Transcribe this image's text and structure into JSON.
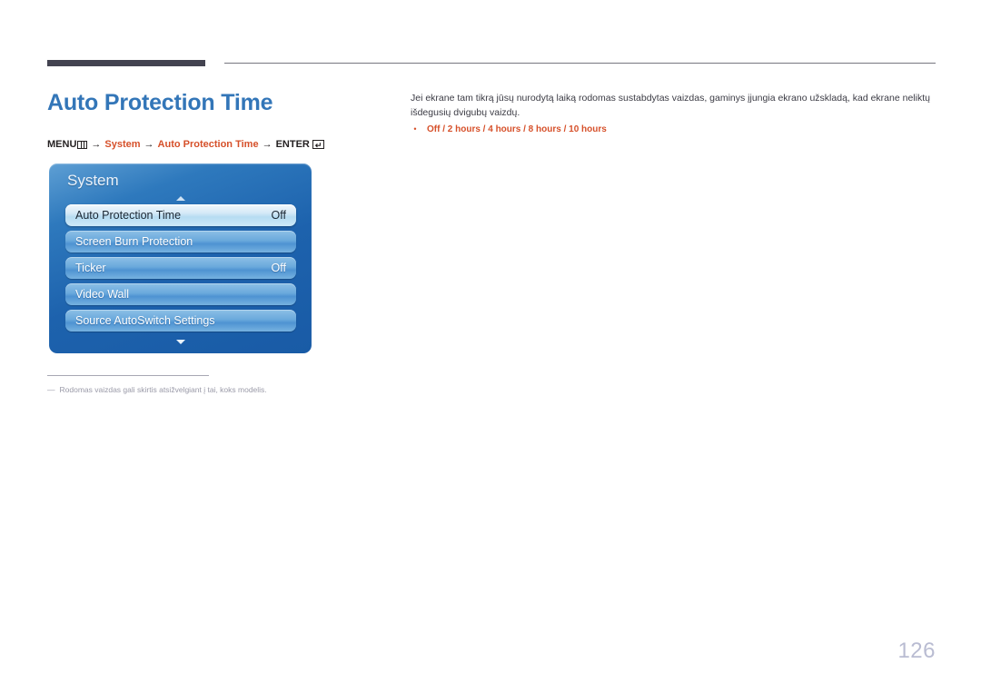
{
  "header": {
    "rule_thick_color": "#434350",
    "rule_thin_color": "#77777f"
  },
  "document": {
    "title": "Auto Protection Time",
    "title_color": "#3376b8",
    "page_number": "126"
  },
  "menu_path": {
    "menu_label": "MENU",
    "menu_icon": "menu-grid-icon",
    "arrow": "→",
    "step1": "System",
    "step2": "Auto Protection Time",
    "enter_label": "ENTER",
    "enter_icon": "enter-return-icon",
    "accent_color": "#d6502a"
  },
  "osd": {
    "title": "System",
    "scroll_up_icon": "chevron-up-icon",
    "scroll_down_icon": "chevron-down-icon",
    "items": [
      {
        "label": "Auto Protection Time",
        "value": "Off",
        "selected": true
      },
      {
        "label": "Screen Burn Protection",
        "value": "",
        "selected": false
      },
      {
        "label": "Ticker",
        "value": "Off",
        "selected": false
      },
      {
        "label": "Video Wall",
        "value": "",
        "selected": false
      },
      {
        "label": "Source AutoSwitch Settings",
        "value": "",
        "selected": false
      }
    ]
  },
  "footnote": {
    "dash": "―",
    "text": "Rodomas vaizdas gali skirtis atsižvelgiant į tai, koks modelis."
  },
  "description": {
    "paragraph": "Jei ekrane tam tikrą jūsų nurodytą laiką rodomas sustabdytas vaizdas, gaminys įjungia ekrano užskladą, kad ekrane neliktų išdegusių dvigubų vaizdų.",
    "bullet_marker": "•",
    "options_line": "Off / 2 hours / 4 hours / 8 hours / 10 hours"
  }
}
